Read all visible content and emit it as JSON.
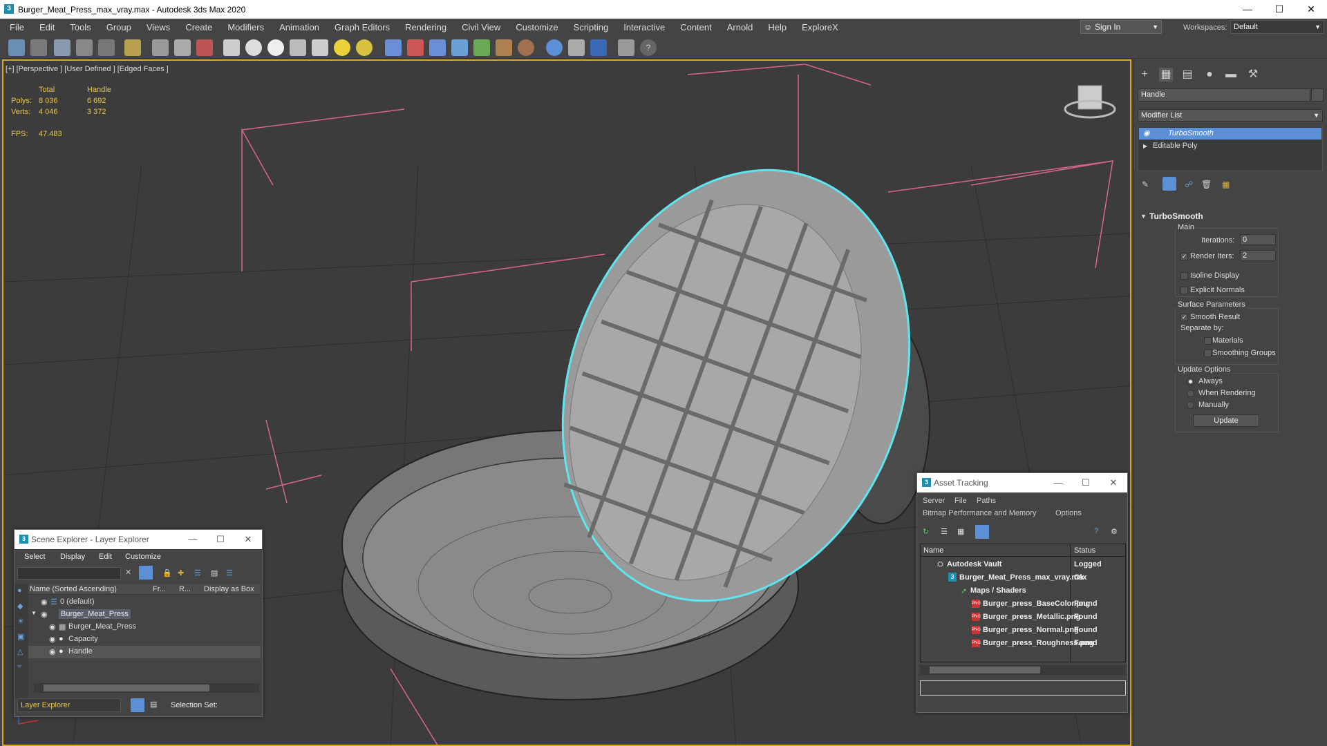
{
  "window": {
    "title": "Burger_Meat_Press_max_vray.max - Autodesk 3ds Max 2020",
    "minimize": "—",
    "maximize": "☐",
    "close": "✕"
  },
  "menu": [
    "File",
    "Edit",
    "Tools",
    "Group",
    "Views",
    "Create",
    "Modifiers",
    "Animation",
    "Graph Editors",
    "Rendering",
    "Civil View",
    "Customize",
    "Scripting",
    "Interactive",
    "Content",
    "Arnold",
    "Help",
    "ExploreX"
  ],
  "signin": {
    "label": "Sign In"
  },
  "workspaces": {
    "label": "Workspaces:",
    "value": "Default"
  },
  "viewport": {
    "label": "[+] [Perspective ] [User Defined ] [Edged Faces ]",
    "stats": {
      "col_total": "Total",
      "col_handle": "Handle",
      "polys_label": "Polys:",
      "polys_total": "8 036",
      "polys_handle": "6 692",
      "verts_label": "Verts:",
      "verts_total": "4 046",
      "verts_handle": "3 372",
      "fps_label": "FPS:",
      "fps_value": "47.483"
    }
  },
  "command_panel": {
    "object_name": "Handle",
    "modifier_list": "Modifier List",
    "stack": [
      "TurboSmooth",
      "Editable Poly"
    ],
    "rollout": {
      "title": "TurboSmooth",
      "main": "Main",
      "iterations_label": "Iterations:",
      "iterations_value": "0",
      "render_iters_label": "Render Iters:",
      "render_iters_value": "2",
      "isoline": "Isoline Display",
      "explicit_normals": "Explicit Normals",
      "surface_params": "Surface Parameters",
      "smooth_result": "Smooth Result",
      "separate_by": "Separate by:",
      "materials": "Materials",
      "smoothing_groups": "Smoothing Groups",
      "update_options": "Update Options",
      "always": "Always",
      "when_rendering": "When Rendering",
      "manually": "Manually",
      "update_button": "Update"
    }
  },
  "scene_explorer": {
    "title": "Scene Explorer - Layer Explorer",
    "menu": [
      "Select",
      "Display",
      "Edit",
      "Customize"
    ],
    "columns": {
      "name": "Name (Sorted Ascending)",
      "frozen": "Fr...",
      "render": "R...",
      "display_box": "Display as Box"
    },
    "rows": [
      {
        "name": "0 (default)"
      },
      {
        "name": "Burger_Meat_Press"
      },
      {
        "name": "Burger_Meat_Press"
      },
      {
        "name": "Capacity"
      },
      {
        "name": "Handle"
      }
    ],
    "footer_layer": "Layer Explorer",
    "footer_selection": "Selection Set:"
  },
  "asset_tracking": {
    "title": "Asset Tracking",
    "menu": [
      "Server",
      "File",
      "Paths"
    ],
    "menu2": [
      "Bitmap Performance and Memory",
      "Options"
    ],
    "columns": {
      "name": "Name",
      "status": "Status"
    },
    "rows": [
      {
        "name": "Autodesk Vault",
        "status": "Logged"
      },
      {
        "name": "Burger_Meat_Press_max_vray.max",
        "status": "Ok"
      },
      {
        "name": "Maps / Shaders",
        "status": ""
      },
      {
        "name": "Burger_press_BaseColor.png",
        "status": "Found"
      },
      {
        "name": "Burger_press_Metallic.png",
        "status": "Found"
      },
      {
        "name": "Burger_press_Normal.png",
        "status": "Found"
      },
      {
        "name": "Burger_press_Roughness.png",
        "status": "Found"
      }
    ]
  },
  "colors": {
    "accent_selection": "#5b8fd6",
    "viewport_border": "#d9a520",
    "stat_text": "#e8c74a",
    "selection_outline": "#5ee6f0"
  }
}
